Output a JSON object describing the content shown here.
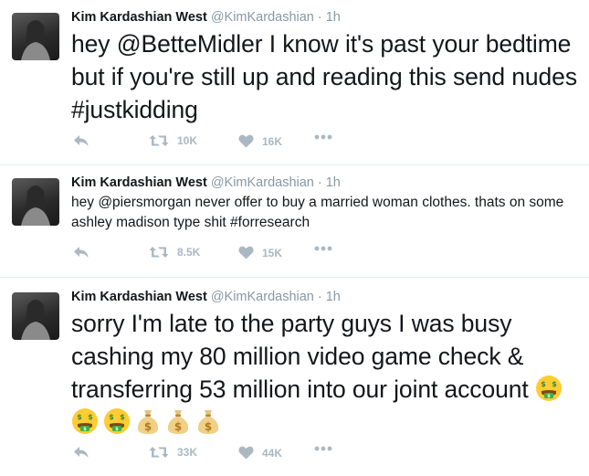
{
  "tweets": [
    {
      "author": {
        "name": "Kim Kardashian West",
        "handle": "@KimKardashian",
        "separator": "·",
        "time": "1h"
      },
      "text": {
        "t1": "hey ",
        "mention": "@BetteMidler",
        "t2": " I know it's past your bedtime but if you're still up and reading this send nudes ",
        "hashtag": "#justkidding"
      },
      "stats": {
        "retweets": "10K",
        "likes": "16K"
      }
    },
    {
      "author": {
        "name": "Kim Kardashian West",
        "handle": "@KimKardashian",
        "separator": "·",
        "time": "1h"
      },
      "text": {
        "t1": "hey ",
        "mention": "@piersmorgan",
        "t2": " never offer to buy a married woman clothes. thats on some ashley madison type shit ",
        "hashtag": "#forresearch"
      },
      "stats": {
        "retweets": "8.5K",
        "likes": "15K"
      }
    },
    {
      "author": {
        "name": "Kim Kardashian West",
        "handle": "@KimKardashian",
        "separator": "·",
        "time": "1h"
      },
      "text": {
        "t1": "sorry I'm late to the party guys I was busy cashing my 80 million video game check & transferring 53 million into our joint account "
      },
      "emojis": [
        "money-mouth-face",
        "money-mouth-face",
        "money-mouth-face",
        "money-bag",
        "money-bag",
        "money-bag"
      ],
      "stats": {
        "retweets": "33K",
        "likes": "44K"
      }
    }
  ],
  "icons": {
    "reply": "reply-icon",
    "retweet": "retweet-icon",
    "like": "heart-icon",
    "more": "more-dots-icon",
    "icon_color": "#aab8c2",
    "secondary_text_color": "#8899a6",
    "divider_color": "#e6ecf0"
  }
}
